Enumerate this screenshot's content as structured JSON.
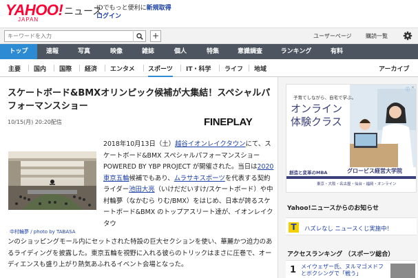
{
  "header": {
    "logo": "YAHOO!",
    "logo_sub": "JAPAN",
    "news": "ニュース",
    "id_prefix": "IDでもっと便利に",
    "id_link": "新規取得",
    "login": "ログイン"
  },
  "search": {
    "placeholder": "キーワードを入力",
    "plus_label": "+",
    "user_page": "ユーザーページ",
    "subscriptions": "購読一覧"
  },
  "nav": {
    "items": [
      {
        "label": "トップ",
        "active": true
      },
      {
        "label": "速報",
        "active": false
      },
      {
        "label": "写真",
        "active": false
      },
      {
        "label": "映像",
        "active": false
      },
      {
        "label": "雑誌",
        "active": false
      },
      {
        "label": "個人",
        "active": false
      },
      {
        "label": "特集",
        "active": false
      },
      {
        "label": "意識調査",
        "active": false
      },
      {
        "label": "ランキング",
        "active": false
      },
      {
        "label": "有料",
        "active": false
      }
    ]
  },
  "subnav": {
    "items": [
      "主要",
      "国内",
      "国際",
      "経済",
      "エンタメ",
      "スポーツ",
      "IT・科学",
      "ライフ",
      "地域"
    ],
    "active": "スポーツ",
    "archive": "アーカイブ"
  },
  "article": {
    "headline": "スケートボード&BMXオリンピック候補が大集結！スペシャルパフォーマンスショー",
    "dateline": "10/15(月) 20:20配信",
    "source": "FINEPLAY",
    "photo_caption": "中村輪夢 / photo by TABASA",
    "p1": "2018年10月13日（土）",
    "p1_link1": "越谷イオンレイクタウン",
    "p2": "にて、スケートボード&BMX スペシャルパフォーマンスショー POWERED BY YBP PROJECT が開催された。当日は",
    "p2_link": "2020東京五輪",
    "p3": "候補でもあり、",
    "p3_link": "ムラサキスポーツ",
    "p4": "を代表する契約ライダー",
    "p4_link": "池田大亮",
    "p5": "（いけだだいすけ/スケートボード）や中村輪夢（なかむら りむ/BMX）をはじめ、日本が誇るスケートボード&BMX のトップアスリート達が、イオンレイクタウ",
    "cont": "ンのショッピングモール内にセットされた特設の巨大セクションを使い、華麗かつ迫力のあるライディングを披露した。東京五輪を視野に入れる彼らのトリックはまさに圧巻で、オーディエンスも盛り上がり熱気あふれるイベント会場となった。"
  },
  "ad": {
    "top_text": "子育てしながら、自宅で学ぶ。",
    "title_line1": "オンライン",
    "title_line2": "体験クラス",
    "foot_left": "創造と変革のMBA",
    "foot_right": "グロービス経営大学院",
    "foot_small": "東京・大阪・名古屋・仙台・福岡・オンライン"
  },
  "notice": {
    "heading": "Yahoo!ニュースからのお知らせ",
    "logo_letter": "T",
    "text": "ハズレなし ニュースくじ実施中！"
  },
  "ranking": {
    "heading": "アクセスランキング （スポーツ総合）",
    "items": [
      {
        "rank": "1",
        "title": "メイウェザー氏、ヌルマゴメドフとボクシングで「戦う」"
      }
    ]
  },
  "colors": {
    "brand_red": "#ff0033",
    "nav_bg": "#4d5560",
    "nav_active": "#2c8bd2",
    "link": "#1a3fa8"
  }
}
